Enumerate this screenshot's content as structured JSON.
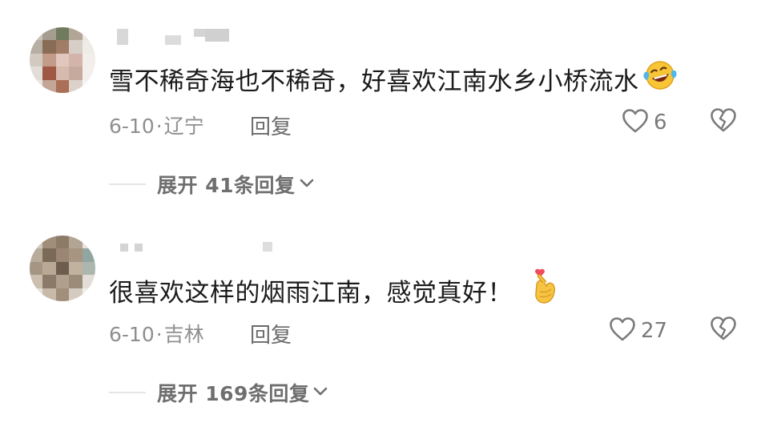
{
  "comments": [
    {
      "text": "雪不稀奇海也不稀奇，好喜欢江南水乡小桥流水",
      "emoji": "laughing-tears-emoji",
      "date": "6-10",
      "dot": "·",
      "location": "辽宁",
      "reply_label": "回复",
      "likes": "6",
      "expand_label": "展开 41条回复"
    },
    {
      "text": "很喜欢这样的烟雨江南，感觉真好！",
      "emoji": "finger-heart-emoji",
      "date": "6-10",
      "dot": "·",
      "location": "吉林",
      "reply_label": "回复",
      "likes": "27",
      "expand_label": "展开 169条回复"
    }
  ],
  "colors": {
    "text": "#1b1b1b",
    "meta": "#8f8f8f",
    "icon": "#7a7a7a",
    "divider": "#e6e6e6"
  }
}
